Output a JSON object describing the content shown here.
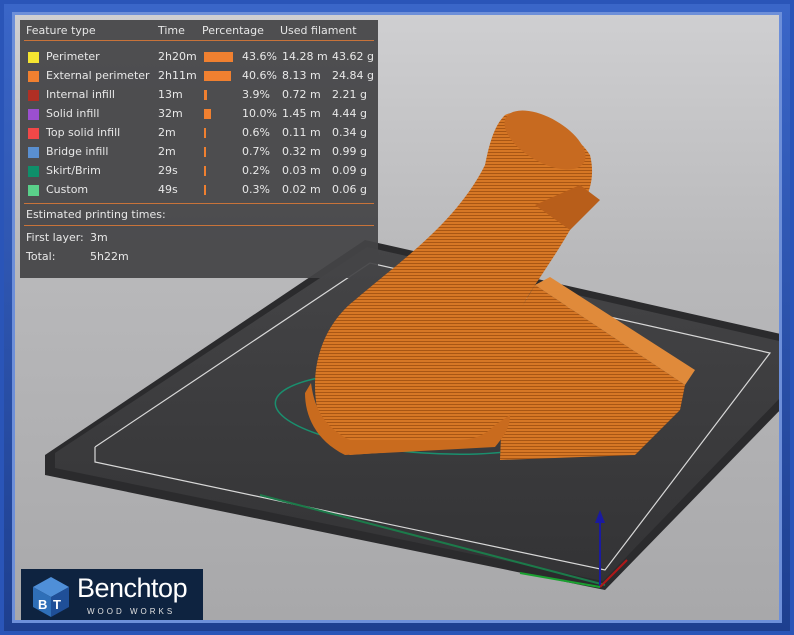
{
  "legend": {
    "headers": {
      "feature_type": "Feature type",
      "time": "Time",
      "percentage": "Percentage",
      "used_filament": "Used filament"
    },
    "rows": [
      {
        "name": "Perimeter",
        "color": "#f5e531",
        "time": "2h20m",
        "percent": "43.6%",
        "percent_value": 43.6,
        "length": "14.28 m",
        "weight": "43.62 g"
      },
      {
        "name": "External perimeter",
        "color": "#f08030",
        "time": "2h11m",
        "percent": "40.6%",
        "percent_value": 40.6,
        "length": "8.13 m",
        "weight": "24.84 g"
      },
      {
        "name": "Internal infill",
        "color": "#b02f24",
        "time": "13m",
        "percent": "3.9%",
        "percent_value": 3.9,
        "length": "0.72 m",
        "weight": "2.21 g"
      },
      {
        "name": "Solid infill",
        "color": "#9b4fd0",
        "time": "32m",
        "percent": "10.0%",
        "percent_value": 10.0,
        "length": "1.45 m",
        "weight": "4.44 g"
      },
      {
        "name": "Top solid infill",
        "color": "#f04848",
        "time": "2m",
        "percent": "0.6%",
        "percent_value": 0.6,
        "length": "0.11 m",
        "weight": "0.34 g"
      },
      {
        "name": "Bridge infill",
        "color": "#5a8fd0",
        "time": "2m",
        "percent": "0.7%",
        "percent_value": 0.7,
        "length": "0.32 m",
        "weight": "0.99 g"
      },
      {
        "name": "Skirt/Brim",
        "color": "#0f8f6a",
        "time": "29s",
        "percent": "0.2%",
        "percent_value": 0.2,
        "length": "0.03 m",
        "weight": "0.09 g"
      },
      {
        "name": "Custom",
        "color": "#5ad08a",
        "time": "49s",
        "percent": "0.3%",
        "percent_value": 0.3,
        "length": "0.02 m",
        "weight": "0.06 g"
      }
    ],
    "estimated_label": "Estimated printing times:",
    "first_layer_label": "First layer:",
    "first_layer_value": "3m",
    "total_label": "Total:",
    "total_value": "5h22m"
  },
  "logo": {
    "title": "Benchtop",
    "subtitle": "WOOD WORKS"
  },
  "colors": {
    "model": "#d9782a",
    "bed": "#3d3d3f",
    "panel": "#444446",
    "separator": "#c8733a"
  },
  "icons": [
    "axis-gizmo-icon",
    "benchtop-logo-icon"
  ]
}
